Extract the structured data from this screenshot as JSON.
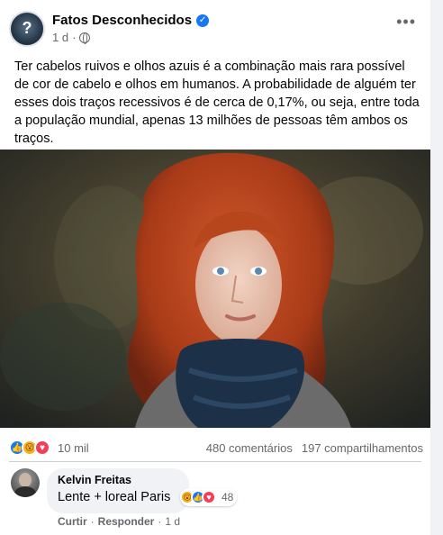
{
  "post": {
    "page_name": "Fatos Desconhecidos",
    "time": "1 d",
    "dot": "·",
    "text": "Ter cabelos ruivos e olhos azuis é a combinação mais rara possível de cor de cabelo e olhos em humanos. A probabilidade de alguém ter esses dois traços recessivos é de cerca de 0,17%, ou seja, entre toda a população mundial, apenas 13 milhões de pessoas têm ambos os traços.",
    "more_icon": "more-options-icon",
    "visibility_icon": "globe-icon"
  },
  "reactions": {
    "count": "10 mil",
    "comments": "480 comentários",
    "shares": "197 compartilhamentos",
    "types": [
      "like",
      "love",
      "wow"
    ]
  },
  "comment": {
    "author": "Kelvin Freitas",
    "text": "Lente + loreal Paris",
    "reaction_count": "48",
    "like_action": "Curtir",
    "reply_action": "Responder",
    "sep": "·",
    "time": "1 d"
  },
  "colors": {
    "accent": "#1877f2",
    "love": "#f33e58",
    "wow": "#f7b125",
    "meta_text": "#65676b",
    "bubble_bg": "#f0f2f5"
  }
}
